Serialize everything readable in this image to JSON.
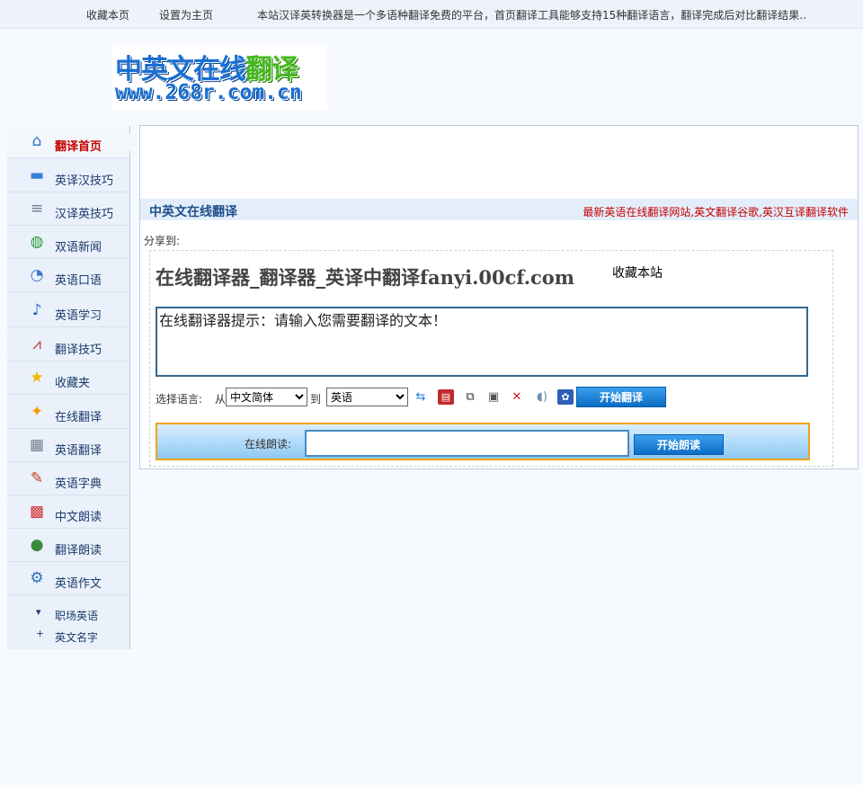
{
  "topbar": {
    "bookmark": "收藏本页",
    "sethome": "设置为主页",
    "notice": "本站汉译英转换器是一个多语种翻译免费的平台，首页翻译工具能够支持15种翻译语言，翻译完成后对比翻译结果.."
  },
  "logo": {
    "line1a": "中英文在线",
    "line1b": "翻译",
    "line2": "www.268r.com.cn"
  },
  "sidebar": {
    "items": [
      {
        "label": "翻译首页",
        "icon": "home-icon",
        "color": "#2a6fc9"
      },
      {
        "label": "英译汉技巧",
        "icon": "book-icon",
        "color": "#3a7fd6"
      },
      {
        "label": "汉译英技巧",
        "icon": "document-icon",
        "color": "#6b7c8f"
      },
      {
        "label": "双语新闻",
        "icon": "globe-icon",
        "color": "#2d9c3a"
      },
      {
        "label": "英语口语",
        "icon": "chat-icon",
        "color": "#3a78c8"
      },
      {
        "label": "英语学习",
        "icon": "music-note-icon",
        "color": "#2a5fc0"
      },
      {
        "label": "翻译技巧",
        "icon": "chart-icon",
        "color": "#c03030"
      },
      {
        "label": "收藏夹",
        "icon": "star-icon",
        "color": "#f3b400"
      },
      {
        "label": "在线翻译",
        "icon": "sparkle-icon",
        "color": "#f39a00"
      },
      {
        "label": "英语翻译",
        "icon": "calendar-icon",
        "color": "#6f7f90"
      },
      {
        "label": "英语字典",
        "icon": "pencil-icon",
        "color": "#c04020"
      },
      {
        "label": "中文朗读",
        "icon": "cart-icon",
        "color": "#d03030"
      },
      {
        "label": "翻译朗读",
        "icon": "ball-icon",
        "color": "#3a8a3a"
      },
      {
        "label": "英语作文",
        "icon": "gear-icon",
        "color": "#2f6fb8"
      }
    ],
    "sub_items": [
      {
        "label": "职场英语",
        "marker": "▾"
      },
      {
        "label": "英文名字",
        "marker": "+"
      }
    ]
  },
  "main": {
    "title": "中英文在线翻译",
    "title_right": "最新英语在线翻译网站,英文翻译谷歌,英汉互译翻译软件",
    "share_label": "分享到:",
    "heading": "在线翻译器_翻译器_英译中翻译fanyi.00cf.com",
    "favorite": "收藏本站",
    "input_value": "在线翻译器提示：请输入您需要翻译的文本！",
    "select_label": "选择语言:",
    "from_label": "从",
    "from_value": "中文简体",
    "to_label": "到",
    "to_value": "英语",
    "translate_button": "开始翻译",
    "read_label": "在线朗读:",
    "read_value": "",
    "read_button": "开始朗读"
  }
}
